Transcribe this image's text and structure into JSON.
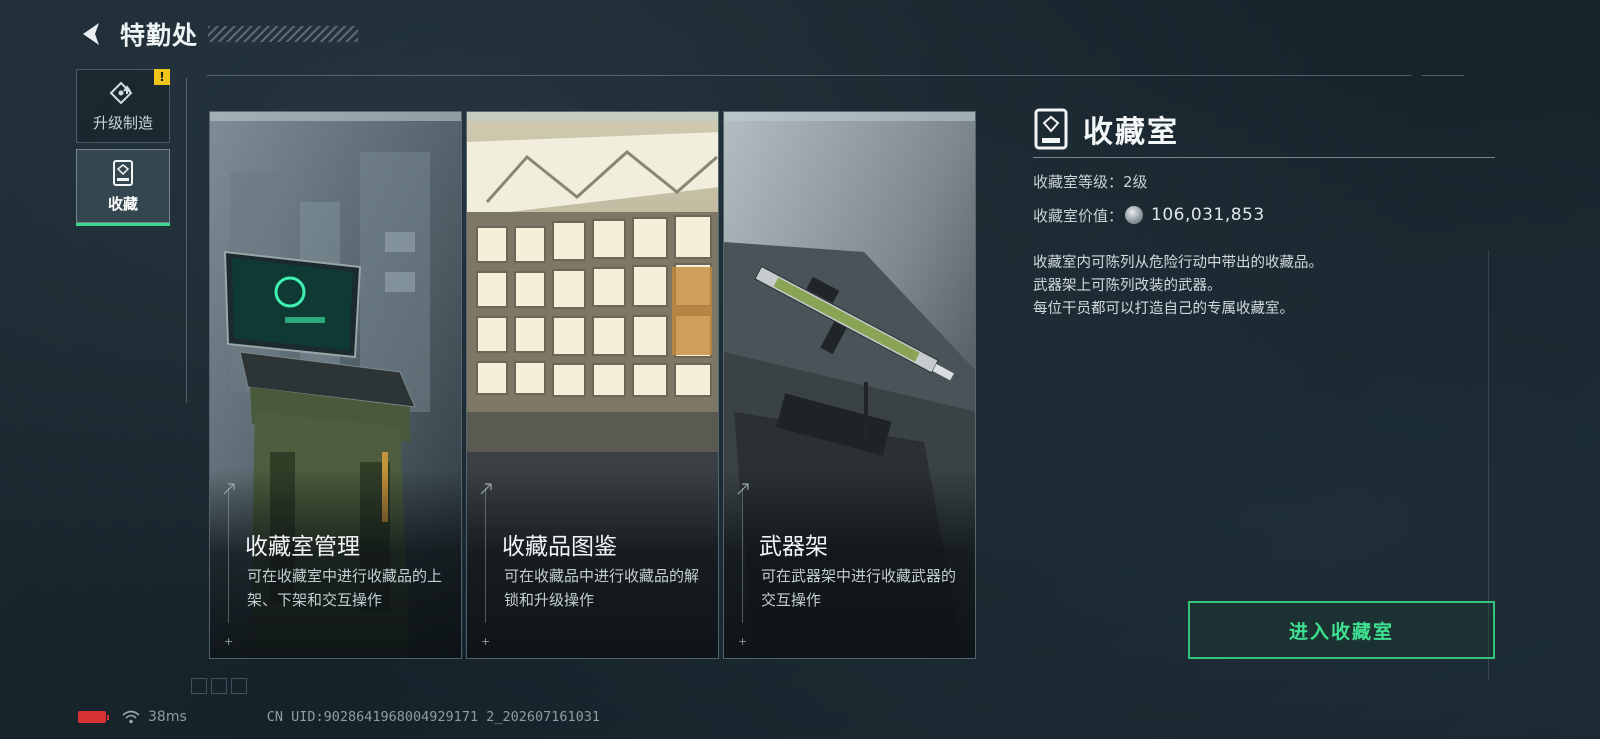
{
  "header": {
    "title": "特勤处"
  },
  "nav": [
    {
      "label": "升级制造",
      "icon": "upgrade-icon",
      "badge": "!"
    },
    {
      "label": "收藏",
      "icon": "collection-icon",
      "active": true
    }
  ],
  "cards": [
    {
      "title": "收藏室管理",
      "desc": "可在收藏室中进行收藏品的上架、下架和交互操作",
      "image": "terminal-computer"
    },
    {
      "title": "收藏品图鉴",
      "desc": "可在收藏品中进行收藏品的解锁和升级操作",
      "image": "collection-shelves"
    },
    {
      "title": "武器架",
      "desc": "可在武器架中进行收藏武器的交互操作",
      "image": "rifle-on-rack"
    }
  ],
  "panel": {
    "title": "收藏室",
    "level_text": "收藏室等级：2级",
    "value_label": "收藏室价值：",
    "value": "106,031,853",
    "desc": [
      "收藏室内可陈列从危险行动中带出的收藏品。",
      "武器架上可陈列改装的武器。",
      "每位干员都可以打造自己的专属收藏室。"
    ],
    "enter_button": "进入收藏室"
  },
  "status": {
    "ping": "38ms",
    "uid": "CN UID:9028641968004929171 2_202607161031"
  },
  "colors": {
    "accent_green": "#3fe08f",
    "badge_yellow": "#f0c419",
    "battery_red": "#d83333"
  }
}
